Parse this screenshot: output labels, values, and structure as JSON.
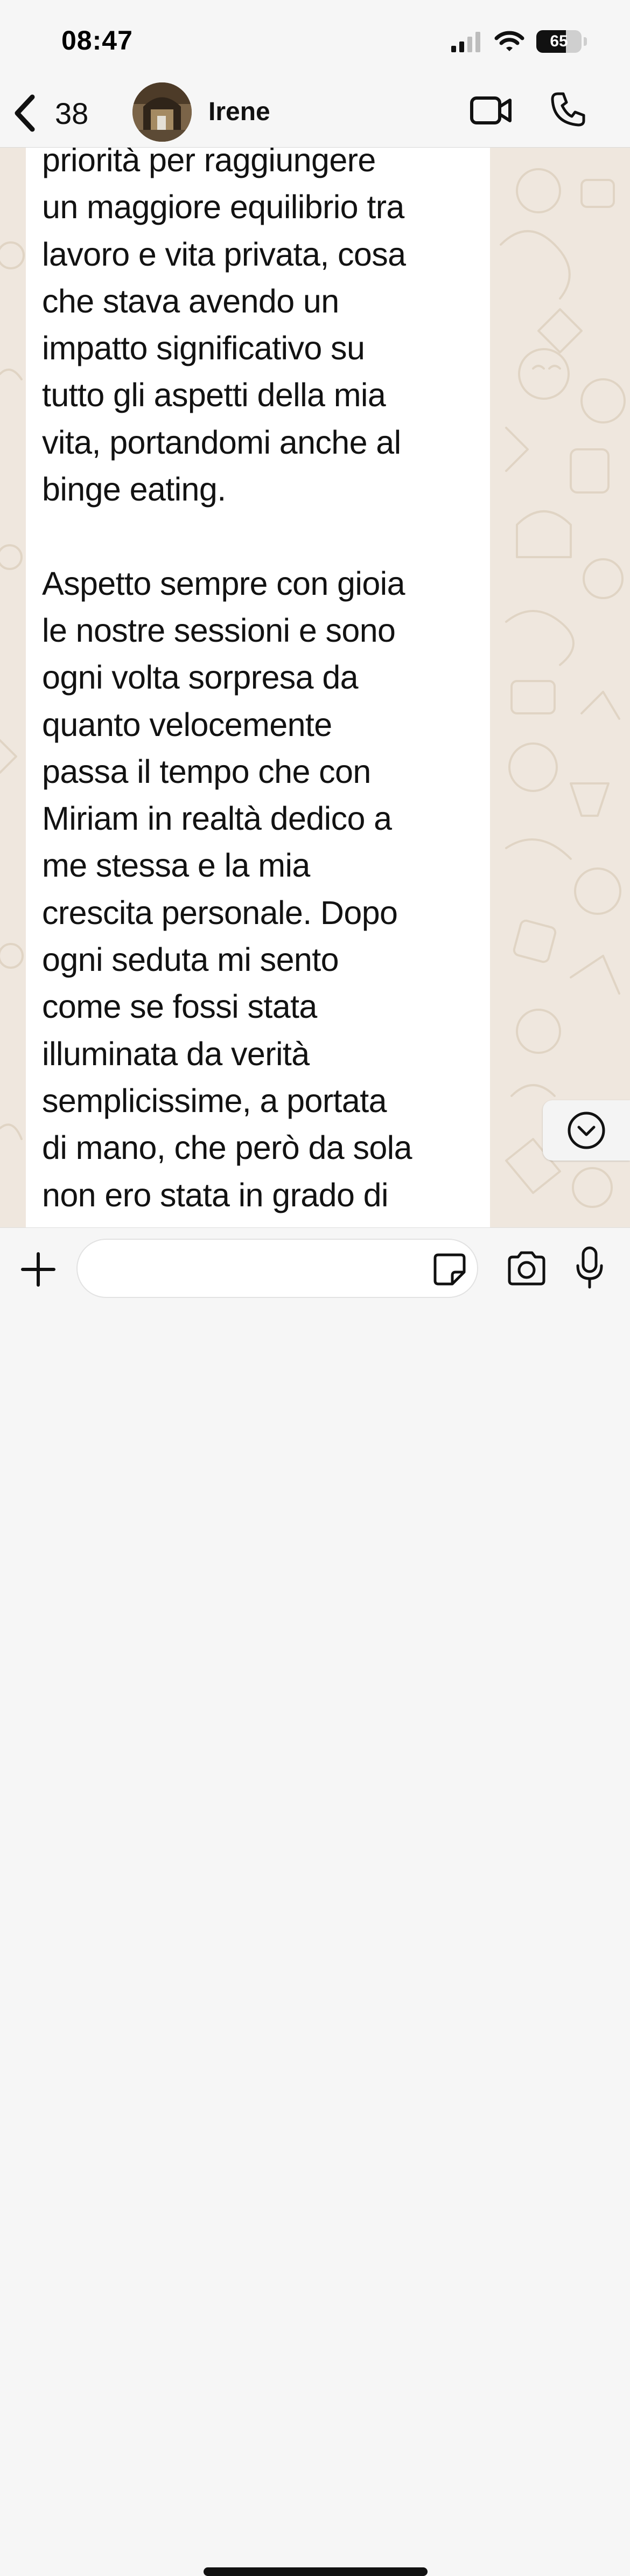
{
  "status_bar": {
    "time": "08:47",
    "battery_level": "65",
    "signal_icon": "cellular-signal-icon",
    "wifi_icon": "wifi-icon"
  },
  "header": {
    "back_icon": "chevron-left-icon",
    "unread_count": "38",
    "contact_name": "Irene",
    "video_icon": "video-camera-icon",
    "call_icon": "phone-icon"
  },
  "message": {
    "text": "priorità per raggiungere\nun maggiore equilibrio tra\nlavoro e vita privata, cosa\nche stava avendo un\nimpatto significativo su\ntutto gli aspetti della mia\nvita, portandomi anche al\nbinge eating.\n\nAspetto sempre con gioia\nle nostre sessioni e sono\nogni volta sorpresa da\nquanto velocemente\npassa il tempo che con\nMiriam in realtà dedico a\nme stessa e la mia\ncrescita personale. Dopo\nogni seduta mi sento\ncome se fossi stata\nilluminata da verità\nsemplicissime, a portata\ndi mano, che però da sola\nnon ero stata in grado di"
  },
  "input_bar": {
    "placeholder": "",
    "attach_icon": "plus-icon",
    "sticker_icon": "sticker-icon",
    "camera_icon": "camera-icon",
    "mic_icon": "microphone-icon"
  },
  "colors": {
    "wallpaper": "#efe7de",
    "bubble": "#ffffff",
    "bar": "#f6f6f6",
    "text": "#121212"
  }
}
